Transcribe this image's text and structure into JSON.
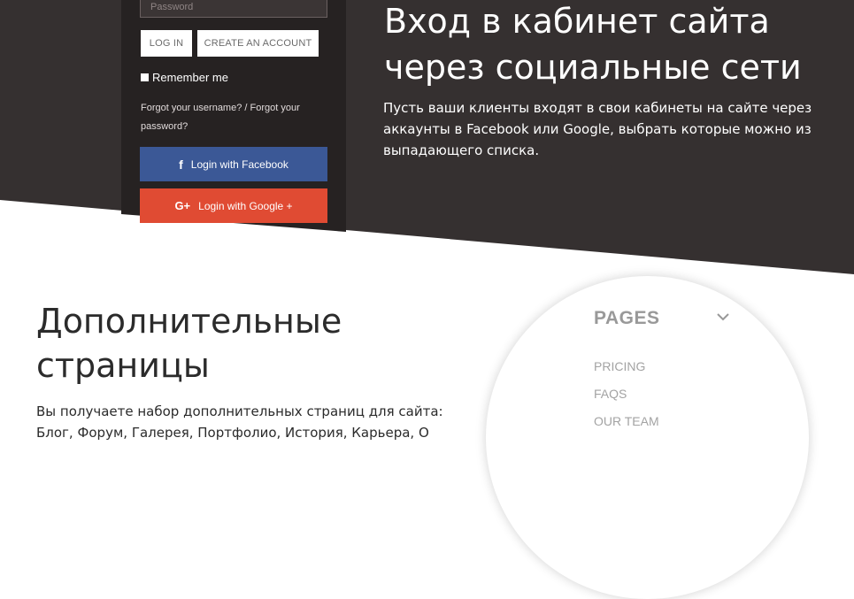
{
  "login": {
    "password_placeholder": "Password",
    "login_button": "LOG IN",
    "create_button": "CREATE AN ACCOUNT",
    "remember_label": "Remember me",
    "forgot_text": "Forgot your username? / Forgot your password?",
    "facebook_icon_glyph": "f",
    "facebook_label": "Login with Facebook",
    "google_icon_glyph": "G+",
    "google_label": "Login with Google +"
  },
  "hero": {
    "title": "Вход в кабинет сайта через социальные сети",
    "text": "Пусть ваши клиенты входят в свои кабинеты на сайте через аккаунты в Facebook или Google, выбрать которые можно из выпадающего списка."
  },
  "pages_section": {
    "title": "Дополнительные страницы",
    "text": "Вы получаете набор дополнительных страниц для сайта: Блог, Форум, Галерея, Портфолио, История, Карьера, О"
  },
  "pages_menu": {
    "title": "PAGES",
    "items": [
      "PRICING",
      "FAQS",
      "OUR TEAM"
    ]
  },
  "colors": {
    "dark_bg": "#353030",
    "panel_bg": "#262222",
    "facebook": "#3b5896",
    "google": "#e04b33"
  },
  "icons": [
    "facebook-icon",
    "google-plus-icon",
    "chevron-down-icon"
  ]
}
